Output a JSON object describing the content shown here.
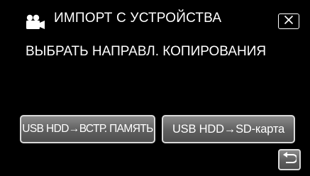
{
  "header": {
    "title": "ИМПОРТ С УСТРОЙСТВА",
    "icon": "video-camera-icon",
    "close_icon": "close-icon"
  },
  "instruction": "ВЫБРАТЬ НАПРАВЛ. КОПИРОВАНИЯ",
  "options": [
    {
      "label": "USB HDD→ВСТР. ПАМЯТЬ"
    },
    {
      "label": "USB HDD→SD-карта"
    }
  ],
  "back_icon": "return-icon",
  "colors": {
    "background": "#000000",
    "text": "#ffffff",
    "button_border": "#d9d9d9",
    "button_fill_top": "#8a8a8a",
    "button_fill_bottom": "#4e4e4e"
  }
}
